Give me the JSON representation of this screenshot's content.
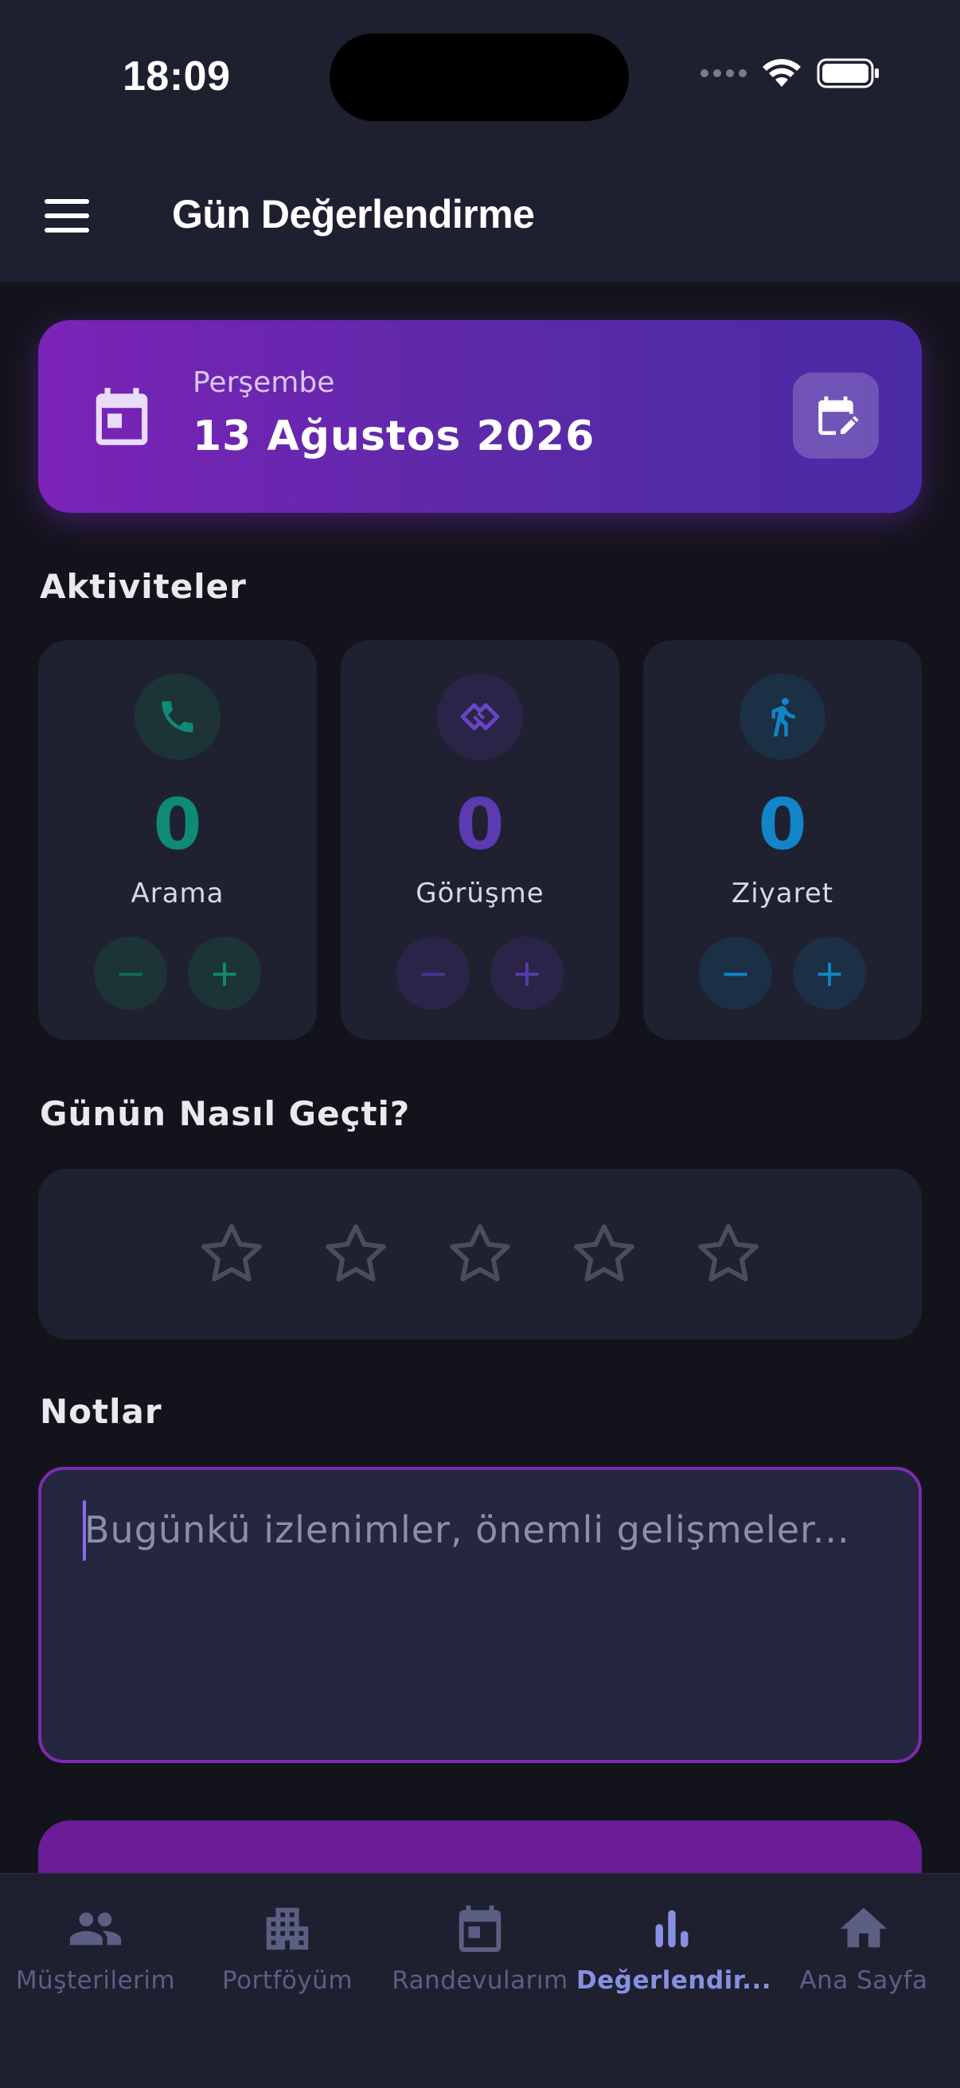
{
  "status_bar": {
    "time": "18:09"
  },
  "header": {
    "title": "Gün Değerlendirme",
    "menu_icon": "hamburger-menu-icon"
  },
  "date_card": {
    "weekday": "Perşembe",
    "date": "13 Ağustos 2026",
    "icon": "calendar-icon",
    "edit_icon": "calendar-edit-icon"
  },
  "activities": {
    "title": "Aktiviteler",
    "items": [
      {
        "label": "Arama",
        "count": "0",
        "icon": "phone-icon",
        "color": "#0f8a74"
      },
      {
        "label": "Görüşme",
        "count": "0",
        "icon": "handshake-icon",
        "color": "#5a3bb0"
      },
      {
        "label": "Ziyaret",
        "count": "0",
        "icon": "walking-person-icon",
        "color": "#1285c8"
      }
    ],
    "minus_symbol": "−",
    "plus_symbol": "+"
  },
  "rating": {
    "title": "Günün Nasıl Geçti?",
    "value": 0,
    "max": 5
  },
  "notes": {
    "title": "Notlar",
    "placeholder": "Bugünkü izlenimler, önemli gelişmeler...",
    "value": ""
  },
  "bottom_nav": {
    "items": [
      {
        "label": "Müşterilerim",
        "icon": "people-icon",
        "active": false
      },
      {
        "label": "Portföyüm",
        "icon": "buildings-icon",
        "active": false
      },
      {
        "label": "Randevularım",
        "icon": "calendar-icon",
        "active": false
      },
      {
        "label": "Değerlendir...",
        "icon": "bar-chart-icon",
        "active": true
      },
      {
        "label": "Ana Sayfa",
        "icon": "home-icon",
        "active": false
      }
    ]
  },
  "colors": {
    "accent": "#7b23b7",
    "background": "#13141b",
    "card": "#1f2130",
    "nav_active": "#8790e2",
    "nav_inactive": "#5b5f83"
  }
}
